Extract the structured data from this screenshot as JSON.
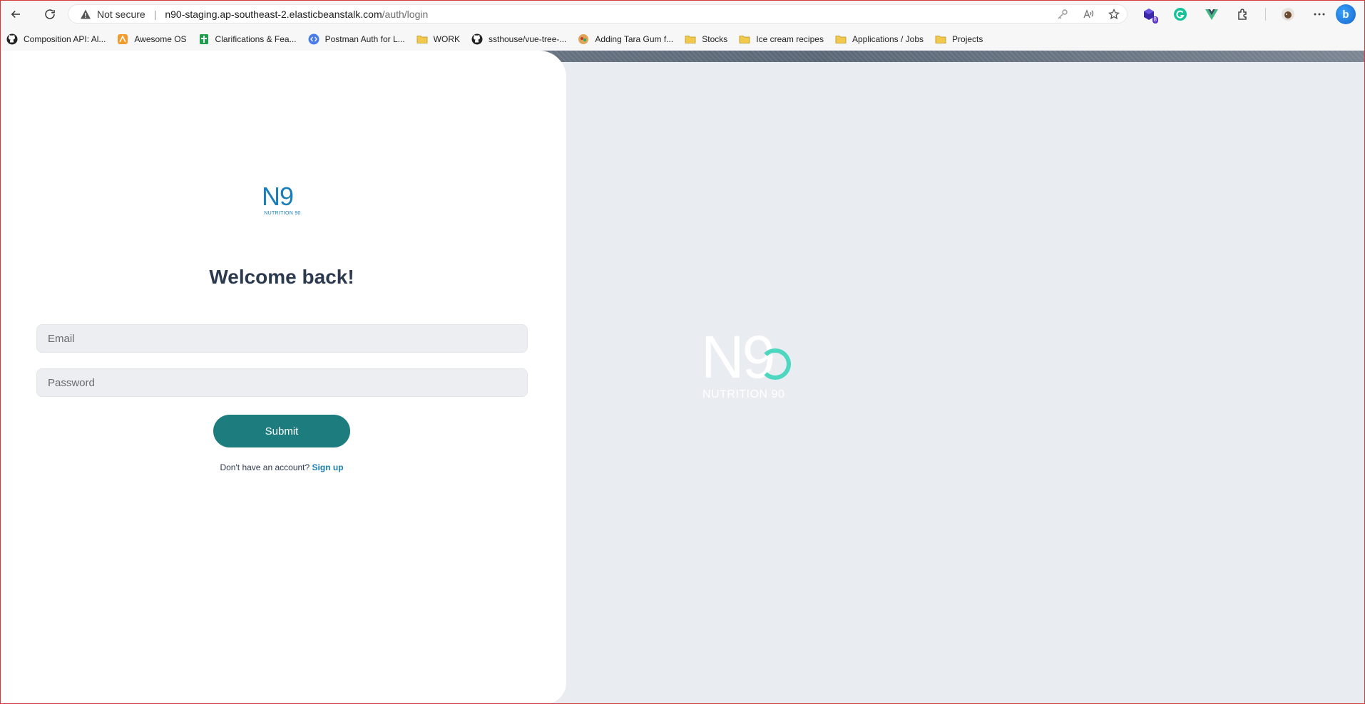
{
  "browser": {
    "security_label": "Not secure",
    "url_host": "n90-staging.ap-southeast-2.elasticbeanstalk.com",
    "url_path": "/auth/login",
    "extension_badge": "8",
    "bing_label": "b"
  },
  "bookmarks": [
    {
      "label": "Composition API: Al...",
      "icon": "github-icon"
    },
    {
      "label": "Awesome OS",
      "icon": "orange-site-icon"
    },
    {
      "label": "Clarifications & Fea...",
      "icon": "sheets-icon"
    },
    {
      "label": "Postman Auth for L...",
      "icon": "code-icon"
    },
    {
      "label": "WORK",
      "icon": "folder-icon"
    },
    {
      "label": "ssthouse/vue-tree-...",
      "icon": "github-icon"
    },
    {
      "label": "Adding Tara Gum f...",
      "icon": "recipe-icon"
    },
    {
      "label": "Stocks",
      "icon": "folder-icon"
    },
    {
      "label": "Ice cream recipes",
      "icon": "folder-icon"
    },
    {
      "label": "Applications / Jobs",
      "icon": "folder-icon"
    },
    {
      "label": "Projects",
      "icon": "folder-icon"
    }
  ],
  "login": {
    "logo_mark": "N9",
    "logo_sub": "NUTRITION 90",
    "heading": "Welcome back!",
    "email_placeholder": "Email",
    "password_placeholder": "Password",
    "submit_label": "Submit",
    "signup_prompt": "Don't have an account?",
    "signup_link": "Sign up"
  },
  "brand_panel": {
    "logo_mark": "N9",
    "logo_sub": "NUTRITION 90"
  },
  "colors": {
    "accent_teal": "#1c7c7e",
    "brand_blue": "#1a7fb8",
    "ring_mint": "#4dd6c0",
    "panel_bg": "#e9ecf1",
    "heading_text": "#2c3a4f"
  }
}
